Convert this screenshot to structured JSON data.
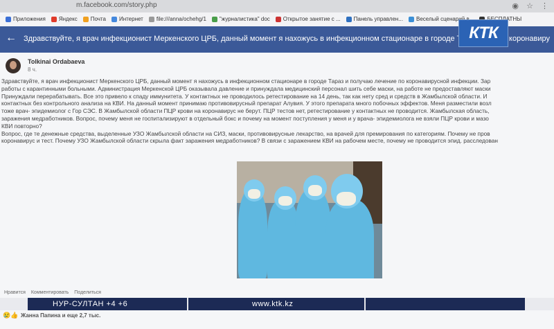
{
  "browser": {
    "url": "m.facebook.com/story.php",
    "bookmarks": [
      {
        "label": "Приложения",
        "color": "#3b6fd6"
      },
      {
        "label": "Яндекс",
        "color": "#e03b2b"
      },
      {
        "label": "Почта",
        "color": "#f0a020"
      },
      {
        "label": "Интернет",
        "color": "#4488dd"
      },
      {
        "label": "file:///anna/ochehg/1",
        "color": "#999999"
      },
      {
        "label": "\"журналистика\" doc",
        "color": "#4a9e4a"
      },
      {
        "label": "Открытое занятие с ...",
        "color": "#cc3333"
      },
      {
        "label": "Панель управлен...",
        "color": "#2f70c0"
      },
      {
        "label": "Веселый сценарий в...",
        "color": "#3b8fd6"
      },
      {
        "label": "БЕСПЛАТНЫ",
        "color": "#333333"
      }
    ]
  },
  "header": {
    "title": "Здравствуйте, я врач инфекционист Меркенского ЦРБ, данный момент я нахожусь в инфекционном стационаре в городе Тараз и пол",
    "right_text": "по коронавиру"
  },
  "logo": {
    "text": "КТК"
  },
  "post": {
    "author": "Tolkinai Ordabaeva",
    "time": "8 ч.",
    "lines": [
      "Здравствуйте, я врач инфекционист Меркенского ЦРБ, данный момент я нахожусь в инфекционном стационаре в городе Тараз и получаю лечение по коронавирусной инфекции. Зар",
      "работы с карантинными больными. Администрация Меркенской ЦРБ оказывала давление и принуждала медицинский персонал шить себе маски, на работе не предоставляют маски",
      "Принуждали перерабатывать. Все это привело к спаду иммунитета. У контактных не проводилось ретестирование на 14 день, так как нету сред и средств в Жамбылской области. И",
      "контактных без контрольного анализа на КВИ. На данный момент принимаю противовирусный препарат Алувия. У этого препарата много побочных эффектов. Меня разместили возл",
      "тоже врач- эпидемиолог с Гор СЭС. В Жамбылской области ПЦР крови на коронавирус не берут. ПЦР тестов нет, ретестирование у контактных не проводится. Жамбылская область,",
      "заражения медработников. Вопрос, почему меня не госпитализируют в отдельный бокс и почему на момент поступления у меня и у врача- эпидемиолога не взяли ПЦР крови и мазо",
      "КВИ повторно?",
      "Вопрос, где те денежные средства, выделенные УЗО Жамбылской области на СИЗ, маски, противовирусные лекарство, на врачей для премирования по категориям. Почему не пров",
      "коронавирус и тест. Почему УЗО Жамбылской области скрыла факт заражения медработников? В связи с заражением КВИ на рабочем месте, почему не проводится эпид. расследован"
    ]
  },
  "actions": [
    "Нравится",
    "Комментировать",
    "Поделиться"
  ],
  "ticker": {
    "left": "НУР-СУЛТАН +4 +6",
    "center": "www.ktk.kz"
  },
  "likes": {
    "text": "Жанна Папина и еще 2,7 тыс."
  }
}
